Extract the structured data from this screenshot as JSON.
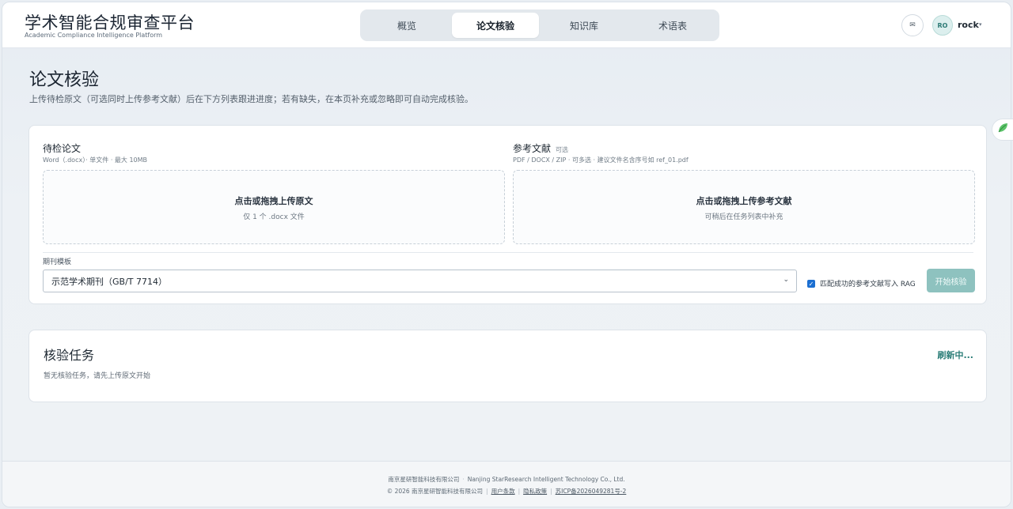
{
  "header": {
    "brand_title": "学术智能合规审查平台",
    "brand_subtitle": "Academic Compliance Intelligence Platform",
    "tabs": [
      {
        "label": "概览",
        "active": false
      },
      {
        "label": "论文核验",
        "active": true
      },
      {
        "label": "知识库",
        "active": false
      },
      {
        "label": "术语表",
        "active": false
      }
    ],
    "mail_icon": "✉",
    "avatar_initials": "RO",
    "username": "rock",
    "user_menu_icon": "▾"
  },
  "page": {
    "title": "论文核验",
    "description": "上传待检原文（可选同时上传参考文献）后在下方列表跟进进度；若有缺失，在本页补充或忽略即可自动完成核验。"
  },
  "upload": {
    "manuscript": {
      "label": "待检论文",
      "hint": "Word（.docx）· 单文件 · 最大 10MB",
      "drop_title": "点击或拖拽上传原文",
      "drop_sub": "仅 1 个 .docx 文件"
    },
    "references": {
      "label": "参考文献",
      "optional": "可选",
      "hint": "PDF / DOCX / ZIP · 可多选 · 建议文件名含序号如 ref_01.pdf",
      "drop_title": "点击或拖拽上传参考文献",
      "drop_sub": "可稍后在任务列表中补充"
    },
    "template_label": "期刊模板",
    "template_value": "示范学术期刊（GB/T 7714）",
    "rag_checked": true,
    "rag_label": "匹配成功的参考文献写入 RAG",
    "start_button": "开始核验"
  },
  "tasks": {
    "title": "核验任务",
    "refresh": "刷新中...",
    "empty": "暂无核验任务，请先上传原文开始"
  },
  "footer": {
    "company_cn": "南京星研智能科技有限公司",
    "company_en": "Nanjing StarResearch Intelligent Technology Co., Ltd.",
    "copyright": "© 2026 南京星研智能科技有限公司",
    "terms": "用户条款",
    "privacy": "隐私政策",
    "icp": "苏ICP备2026049281号-2"
  },
  "colors": {
    "accent": "#2a7d77",
    "button_disabled": "#8ec2bf",
    "checkbox": "#1c6fd1"
  },
  "icons": {
    "mail": "mail-icon",
    "select_caret": "chevron-down-icon",
    "side_badge": "leaf-icon"
  }
}
